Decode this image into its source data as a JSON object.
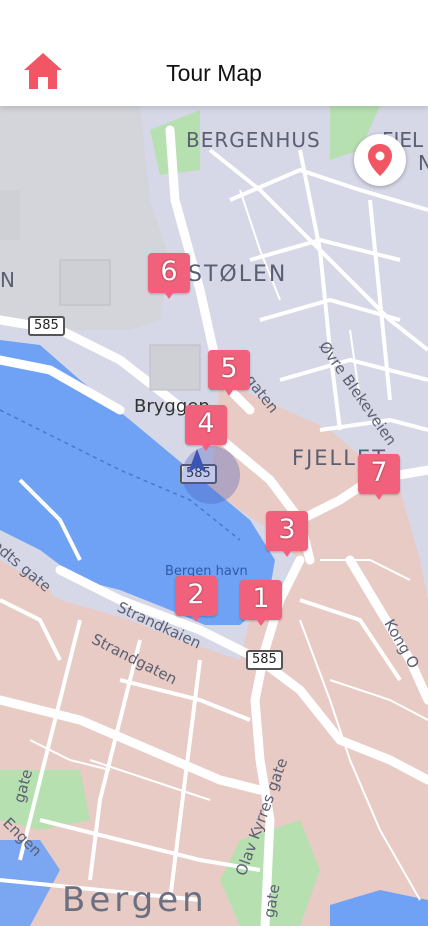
{
  "header": {
    "title": "Tour Map",
    "home_icon": "home-icon"
  },
  "locate_button": {
    "icon": "map-pin-icon"
  },
  "map": {
    "labels": {
      "bergenhus": "BERGENHUS",
      "fjel_top": "FJEL",
      "n_top": "N",
      "stolen": "STØLEN",
      "bryggen": "Bryggen",
      "oevre": "Øvre Blekeveien",
      "fjellet": "FJELLET",
      "regaten": "egaten",
      "sandts": "ndts gate",
      "bergen_havn": "Bergen havn",
      "strandkaien": "Strandkaien",
      "strandgaten": "Strandgaten",
      "kong": "Kong O",
      "olav": "Olav Kyrres gate",
      "engen": "Engen",
      "gate_left": "gate",
      "gate_bottom": "gate",
      "bergen": "Bergen",
      "n_left": "N"
    },
    "shields": {
      "s1": "585",
      "s2": "585",
      "s3": "585"
    },
    "markers": [
      "1",
      "2",
      "3",
      "4",
      "5",
      "6",
      "7"
    ],
    "colors": {
      "marker": "#f2617c",
      "water": "#6fa2f5",
      "park": "#b6e0b0",
      "urban": "#e8cbc5",
      "accent": "#f25563"
    }
  }
}
